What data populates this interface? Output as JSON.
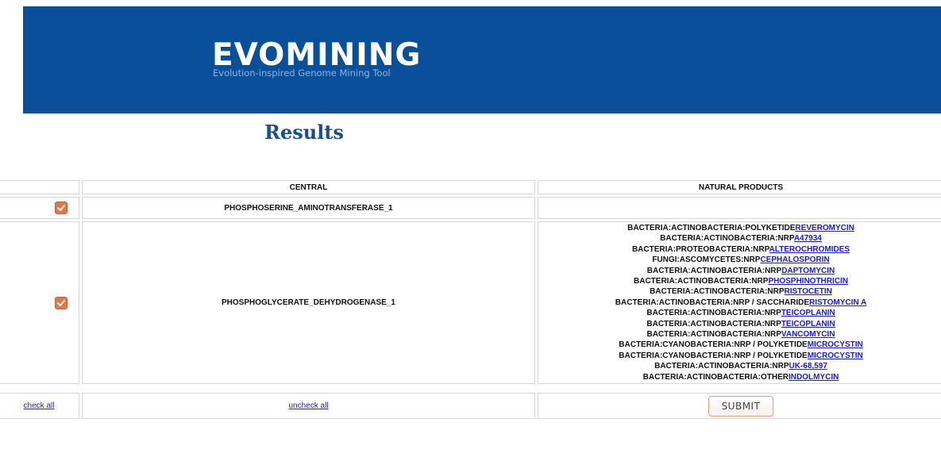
{
  "header": {
    "title": "EVOMINING",
    "subtitle": "Evolution-inspired Genome Mining Tool"
  },
  "page_title": "Results",
  "table": {
    "columns": [
      "",
      "CENTRAL",
      "NATURAL PRODUCTS"
    ],
    "rows": [
      {
        "checked": true,
        "central": "PHOSPHOSERINE_AMINOTRANSFERASE_1",
        "products": []
      },
      {
        "checked": true,
        "central": "PHOSPHOGLYCERATE_DEHYDROGENASE_1",
        "products": [
          {
            "prefix": "BACTERIA:ACTINOBACTERIA:POLYKETIDE",
            "link": "REVEROMYCIN"
          },
          {
            "prefix": "BACTERIA:ACTINOBACTERIA:NRP",
            "link": "A47934"
          },
          {
            "prefix": "BACTERIA:PROTEOBACTERIA:NRP",
            "link": "ALTEROCHROMIDES"
          },
          {
            "prefix": "FUNGI:ASCOMYCETES:NRP",
            "link": "CEPHALOSPORIN"
          },
          {
            "prefix": "BACTERIA:ACTINOBACTERIA:NRP",
            "link": "DAPTOMYCIN"
          },
          {
            "prefix": "BACTERIA:ACTINOBACTERIA:NRP",
            "link": "PHOSPHINOTHRICIN"
          },
          {
            "prefix": "BACTERIA:ACTINOBACTERIA:NRP",
            "link": "RISTOCETIN"
          },
          {
            "prefix": "BACTERIA:ACTINOBACTERIA:NRP / SACCHARIDE",
            "link": "RISTOMYCIN A"
          },
          {
            "prefix": "BACTERIA:ACTINOBACTERIA:NRP",
            "link": "TEICOPLANIN"
          },
          {
            "prefix": "BACTERIA:ACTINOBACTERIA:NRP",
            "link": "TEICOPLANIN"
          },
          {
            "prefix": "BACTERIA:ACTINOBACTERIA:NRP",
            "link": "VANCOMYCIN"
          },
          {
            "prefix": "BACTERIA:CYANOBACTERIA:NRP / POLYKETIDE",
            "link": "MICROCYSTIN"
          },
          {
            "prefix": "BACTERIA:CYANOBACTERIA:NRP / POLYKETIDE",
            "link": "MICROCYSTIN"
          },
          {
            "prefix": "BACTERIA:ACTINOBACTERIA:NRP",
            "link": "UK-68,597"
          },
          {
            "prefix": "BACTERIA:ACTINOBACTERIA:OTHER",
            "link": "INDOLMYCIN"
          }
        ]
      }
    ]
  },
  "footer": {
    "check_all": "check all",
    "uncheck_all": "uncheck all",
    "submit": "SUBMIT"
  },
  "colors": {
    "banner": "#0a4f9a",
    "title": "#1b4f8a",
    "checkbox": "#e2784a",
    "link": "#1a1adb"
  }
}
